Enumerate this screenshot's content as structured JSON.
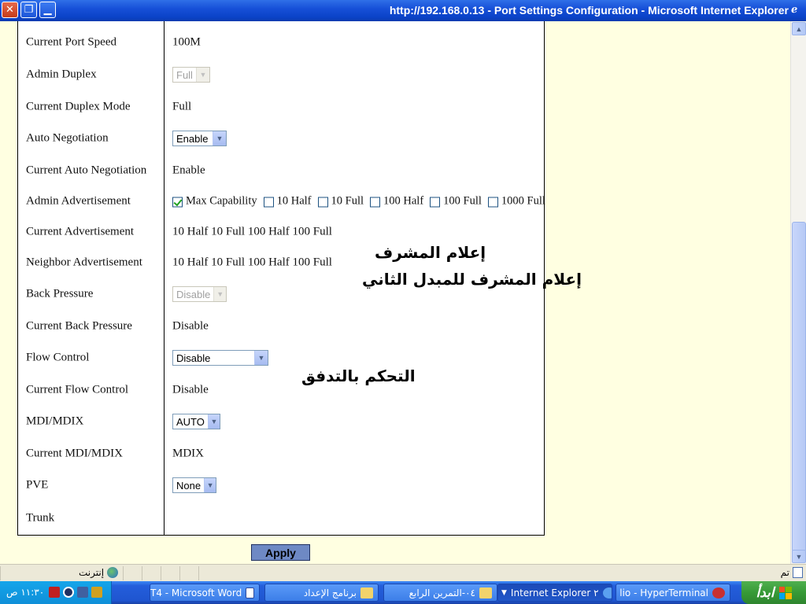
{
  "window": {
    "title": "http://192.168.0.13 - Port Settings Configuration - Microsoft Internet Explorer",
    "close": "✕",
    "restore": "❐",
    "minimize": "▁"
  },
  "rows": [
    {
      "label": "Current Port Speed",
      "value": "100M"
    },
    {
      "label": "Admin Duplex",
      "select": "Full",
      "disabled": true
    },
    {
      "label": "Current Duplex Mode",
      "value": "Full"
    },
    {
      "label": "Auto Negotiation",
      "select": "Enable"
    },
    {
      "label": "Current Auto Negotiation",
      "value": "Enable"
    },
    {
      "label": "Admin Advertisement"
    },
    {
      "label": "Current Advertisement",
      "value": "10 Half 10 Full 100 Half 100 Full"
    },
    {
      "label": "Neighbor Advertisement",
      "value": "10 Half 10 Full 100 Half 100 Full"
    },
    {
      "label": "Back Pressure",
      "select": "Disable",
      "disabled": true
    },
    {
      "label": "Current Back Pressure",
      "value": "Disable"
    },
    {
      "label": "Flow Control",
      "select": "Disable"
    },
    {
      "label": "Current Flow Control",
      "value": "Disable"
    },
    {
      "label": "MDI/MDIX",
      "select": "AUTO"
    },
    {
      "label": "Current MDI/MDIX",
      "value": "MDIX"
    },
    {
      "label": "PVE",
      "select": "None"
    },
    {
      "label": "Trunk"
    }
  ],
  "advertisement_options": [
    {
      "label": "Max Capability",
      "checked": true
    },
    {
      "label": "10 Half",
      "checked": false
    },
    {
      "label": "10 Full",
      "checked": false
    },
    {
      "label": "100 Half",
      "checked": false
    },
    {
      "label": "100 Full",
      "checked": false
    },
    {
      "label": "1000 Full",
      "checked": false
    }
  ],
  "annotations": {
    "current_advertisement": "إعلام المشرف",
    "neighbor_advertisement": "إعلام المشرف للمبدل الثاني",
    "flow_control": "التحكم بالتدفق"
  },
  "apply_label": "Apply",
  "statusbar": {
    "done": "تم",
    "zone": "إنترنت"
  },
  "taskbar": {
    "start": "ابدأ",
    "tasks": [
      {
        "label": "lio - HyperTerminal"
      },
      {
        "label": "Internet Explorer ٢"
      },
      {
        "label": "٠٤-التمرين الرابع"
      },
      {
        "label": "برنامج الإعداد"
      },
      {
        "label": "T4 - Microsoft Word"
      }
    ],
    "clock": "١١:٣٠ ص"
  }
}
